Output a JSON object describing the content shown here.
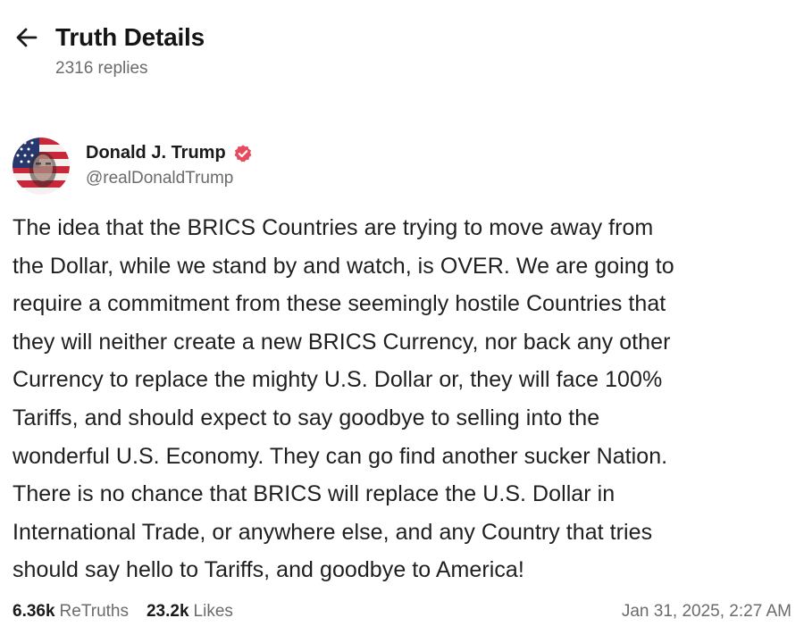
{
  "header": {
    "back_icon": "arrow-left-icon",
    "title": "Truth Details",
    "reply_count": "2316 replies"
  },
  "post": {
    "author": {
      "name": "Donald J. Trump",
      "handle": "@realDonaldTrump",
      "verified_icon": "verified-badge-icon",
      "verified_color": "#e84a5f"
    },
    "body": "The idea that the BRICS Countries are trying to move away from\nthe Dollar, while we stand by and watch, is OVER. We are going to\nrequire a commitment from these seemingly hostile Countries that\nthey will neither create a new BRICS Currency, nor back any other\nCurrency to replace the mighty U.S. Dollar or, they will face 100%\nTariffs, and should expect to say goodbye to selling into the\nwonderful U.S. Economy. They can go find another sucker Nation.\nThere is no chance that BRICS will replace the U.S. Dollar in\nInternational Trade, or anywhere else, and any Country that tries\nshould say hello to Tariffs, and goodbye to America!",
    "stats": {
      "retruths_count": "6.36k",
      "retruths_label": "ReTruths",
      "likes_count": "23.2k",
      "likes_label": "Likes"
    },
    "timestamp": "Jan 31, 2025, 2:27 AM"
  }
}
